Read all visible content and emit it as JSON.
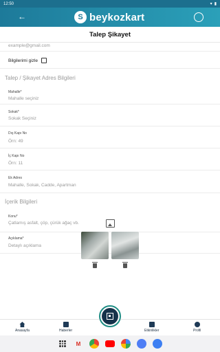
{
  "status": {
    "time": "12:50",
    "icons": [
      "wifi-icon",
      "battery-icon"
    ]
  },
  "appbar": {
    "brand": "beykozkart"
  },
  "page_title": "Talep Şikayet",
  "email_placeholder": "example@gmail.com",
  "hide_info_label": "Bilgilerimi gizle",
  "address_section": {
    "title": "Talep / Şikayet Adres Bilgileri",
    "fields": [
      {
        "label": "Mahalle*",
        "placeholder": "Mahalle seçiniz"
      },
      {
        "label": "Sokak*",
        "placeholder": "Sokak Seçiniz"
      },
      {
        "label": "Dış Kapı No",
        "placeholder": "Örn: 49"
      },
      {
        "label": "İç Kapı No",
        "placeholder": "Örn: 11"
      },
      {
        "label": "Ek Adres",
        "placeholder": "Mahalle, Sokak, Cadde, Apartman"
      }
    ]
  },
  "content_section": {
    "title": "İçerik Bilgileri",
    "fields": [
      {
        "label": "Konu*",
        "placeholder": "Çatlamış asfalt, çöp, çürük ağaç vb."
      },
      {
        "label": "Açıklama*",
        "placeholder": "Detaylı açıklama"
      }
    ]
  },
  "bottom_nav": [
    {
      "label": "Anasayfa",
      "icon": "home-icon"
    },
    {
      "label": "Haberler",
      "icon": "news-icon"
    },
    {
      "label": "Etkinlikler",
      "icon": "events-icon"
    },
    {
      "label": "Profil",
      "icon": "profile-icon"
    }
  ],
  "dock": [
    "apps-grid-icon",
    "gmail-icon",
    "chrome-icon",
    "youtube-icon",
    "photos-icon",
    "camera-icon",
    "messages-icon"
  ],
  "colors": {
    "appbar": "#1d7a9a",
    "fab_border": "#1e8c84",
    "nav": "#1e3a56"
  }
}
